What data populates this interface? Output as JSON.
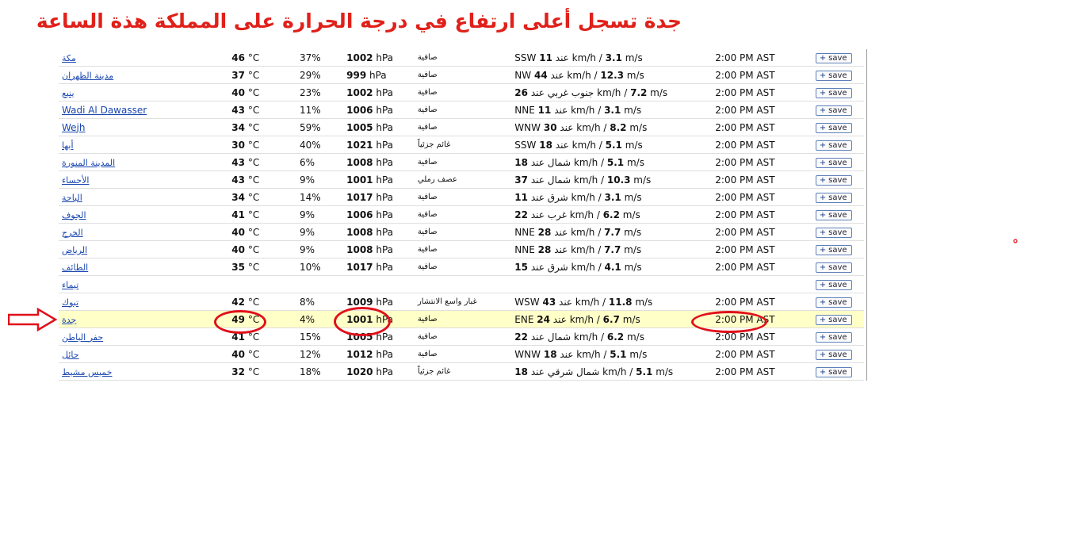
{
  "headline": "جدة تسجل أعلى ارتفاع في درجة الحرارة  على المملكة هذة الساعة",
  "colors": {
    "annotation": "#e0201a",
    "link": "#1a47b0",
    "highlight_row": "#ffffc8"
  },
  "save_label": "save",
  "rows": [
    {
      "city": "مكة",
      "temp": "46",
      "temp_unit": " °C",
      "humidity": "37%",
      "pressure": "1002",
      "pressure_unit": " hPa",
      "condition": "صافية",
      "wind_dir": "SSW",
      "wind_kmh": "11",
      "wind_mid": " عند km/h / ",
      "wind_ms": "3.1",
      "wind_unit": " m/s",
      "time": "2:00 PM AST"
    },
    {
      "city": "مدينة الظهران",
      "temp": "37",
      "temp_unit": " °C",
      "humidity": "29%",
      "pressure": "999",
      "pressure_unit": " hPa",
      "condition": "صافية",
      "wind_dir": "NW",
      "wind_kmh": "44",
      "wind_mid": " عند km/h / ",
      "wind_ms": "12.3",
      "wind_unit": " m/s",
      "time": "2:00 PM AST"
    },
    {
      "city": "ينبع",
      "temp": "40",
      "temp_unit": " °C",
      "humidity": "23%",
      "pressure": "1002",
      "pressure_unit": " hPa",
      "condition": "صافية",
      "wind_dir": "",
      "wind_kmh": "26",
      "wind_mid": " جنوب غربي عند km/h / ",
      "wind_ms": "7.2",
      "wind_unit": " m/s",
      "time": "2:00 PM AST"
    },
    {
      "city": "Wadi Al Dawasser",
      "temp": "43",
      "temp_unit": " °C",
      "humidity": "11%",
      "pressure": "1006",
      "pressure_unit": " hPa",
      "condition": "صافية",
      "wind_dir": "NNE",
      "wind_kmh": "11",
      "wind_mid": " عند km/h / ",
      "wind_ms": "3.1",
      "wind_unit": " m/s",
      "time": "2:00 PM AST"
    },
    {
      "city": "Wejh",
      "temp": "34",
      "temp_unit": " °C",
      "humidity": "59%",
      "pressure": "1005",
      "pressure_unit": " hPa",
      "condition": "صافية",
      "wind_dir": "WNW",
      "wind_kmh": "30",
      "wind_mid": " عند km/h / ",
      "wind_ms": "8.2",
      "wind_unit": " m/s",
      "time": "2:00 PM AST"
    },
    {
      "city": "أبها",
      "temp": "30",
      "temp_unit": " °C",
      "humidity": "40%",
      "pressure": "1021",
      "pressure_unit": " hPa",
      "condition": "غائم جزئياً",
      "wind_dir": "SSW",
      "wind_kmh": "18",
      "wind_mid": " عند km/h / ",
      "wind_ms": "5.1",
      "wind_unit": " m/s",
      "time": "2:00 PM AST"
    },
    {
      "city": "المدينة المنورة",
      "temp": "43",
      "temp_unit": " °C",
      "humidity": "6%",
      "pressure": "1008",
      "pressure_unit": " hPa",
      "condition": "صافية",
      "wind_dir": "",
      "wind_kmh": "18",
      "wind_mid": " شمال عند km/h / ",
      "wind_ms": "5.1",
      "wind_unit": " m/s",
      "time": "2:00 PM AST"
    },
    {
      "city": "الأحساء",
      "temp": "43",
      "temp_unit": " °C",
      "humidity": "9%",
      "pressure": "1001",
      "pressure_unit": " hPa",
      "condition": "عصف رملي",
      "wind_dir": "",
      "wind_kmh": "37",
      "wind_mid": " شمال عند km/h / ",
      "wind_ms": "10.3",
      "wind_unit": " m/s",
      "time": "2:00 PM AST"
    },
    {
      "city": "الباحة",
      "temp": "34",
      "temp_unit": " °C",
      "humidity": "14%",
      "pressure": "1017",
      "pressure_unit": " hPa",
      "condition": "صافية",
      "wind_dir": "",
      "wind_kmh": "11",
      "wind_mid": " شرق عند km/h / ",
      "wind_ms": "3.1",
      "wind_unit": " m/s",
      "time": "2:00 PM AST"
    },
    {
      "city": "الجوف",
      "temp": "41",
      "temp_unit": " °C",
      "humidity": "9%",
      "pressure": "1006",
      "pressure_unit": " hPa",
      "condition": "صافية",
      "wind_dir": "",
      "wind_kmh": "22",
      "wind_mid": " غرب عند km/h / ",
      "wind_ms": "6.2",
      "wind_unit": " m/s",
      "time": "2:00 PM AST"
    },
    {
      "city": "الخرج",
      "temp": "40",
      "temp_unit": " °C",
      "humidity": "9%",
      "pressure": "1008",
      "pressure_unit": " hPa",
      "condition": "صافية",
      "wind_dir": "NNE",
      "wind_kmh": "28",
      "wind_mid": " عند km/h / ",
      "wind_ms": "7.7",
      "wind_unit": " m/s",
      "time": "2:00 PM AST"
    },
    {
      "city": "الرياض",
      "temp": "40",
      "temp_unit": " °C",
      "humidity": "9%",
      "pressure": "1008",
      "pressure_unit": " hPa",
      "condition": "صافية",
      "wind_dir": "NNE",
      "wind_kmh": "28",
      "wind_mid": " عند km/h / ",
      "wind_ms": "7.7",
      "wind_unit": " m/s",
      "time": "2:00 PM AST"
    },
    {
      "city": "الطائف",
      "temp": "35",
      "temp_unit": " °C",
      "humidity": "10%",
      "pressure": "1017",
      "pressure_unit": " hPa",
      "condition": "صافية",
      "wind_dir": "",
      "wind_kmh": "15",
      "wind_mid": " شرق عند km/h / ",
      "wind_ms": "4.1",
      "wind_unit": " m/s",
      "time": "2:00 PM AST"
    },
    {
      "city": "تيماء",
      "temp": "",
      "temp_unit": "",
      "humidity": "",
      "pressure": "",
      "pressure_unit": "",
      "condition": "",
      "wind_dir": "",
      "wind_kmh": "",
      "wind_mid": "",
      "wind_ms": "",
      "wind_unit": "",
      "time": ""
    },
    {
      "city": "تبوك",
      "temp": "42",
      "temp_unit": " °C",
      "humidity": "8%",
      "pressure": "1009",
      "pressure_unit": " hPa",
      "condition": "غبار واسع الانتشار",
      "wind_dir": "WSW",
      "wind_kmh": "43",
      "wind_mid": " عند km/h / ",
      "wind_ms": "11.8",
      "wind_unit": " m/s",
      "time": "2:00 PM AST"
    },
    {
      "city": "جدة",
      "temp": "49",
      "temp_unit": " °C",
      "humidity": "4%",
      "pressure": "1001",
      "pressure_unit": " hPa",
      "condition": "صافية",
      "wind_dir": "ENE",
      "wind_kmh": "24",
      "wind_mid": " عند km/h / ",
      "wind_ms": "6.7",
      "wind_unit": " m/s",
      "time": "2:00 PM AST",
      "highlight": true
    },
    {
      "city": "حفر الباطن",
      "temp": "41",
      "temp_unit": " °C",
      "humidity": "15%",
      "pressure": "1005",
      "pressure_unit": " hPa",
      "condition": "صافية",
      "wind_dir": "",
      "wind_kmh": "22",
      "wind_mid": " شمال عند km/h / ",
      "wind_ms": "6.2",
      "wind_unit": " m/s",
      "time": "2:00 PM AST"
    },
    {
      "city": "حائل",
      "temp": "40",
      "temp_unit": " °C",
      "humidity": "12%",
      "pressure": "1012",
      "pressure_unit": " hPa",
      "condition": "صافية",
      "wind_dir": "WNW",
      "wind_kmh": "18",
      "wind_mid": " عند km/h / ",
      "wind_ms": "5.1",
      "wind_unit": " m/s",
      "time": "2:00 PM AST"
    },
    {
      "city": "خميس مشيط",
      "temp": "32",
      "temp_unit": " °C",
      "humidity": "18%",
      "pressure": "1020",
      "pressure_unit": " hPa",
      "condition": "غائم جزئياً",
      "wind_dir": "",
      "wind_kmh": "18",
      "wind_mid": " شمال شرقي عند km/h / ",
      "wind_ms": "5.1",
      "wind_unit": " m/s",
      "time": "2:00 PM AST"
    }
  ]
}
